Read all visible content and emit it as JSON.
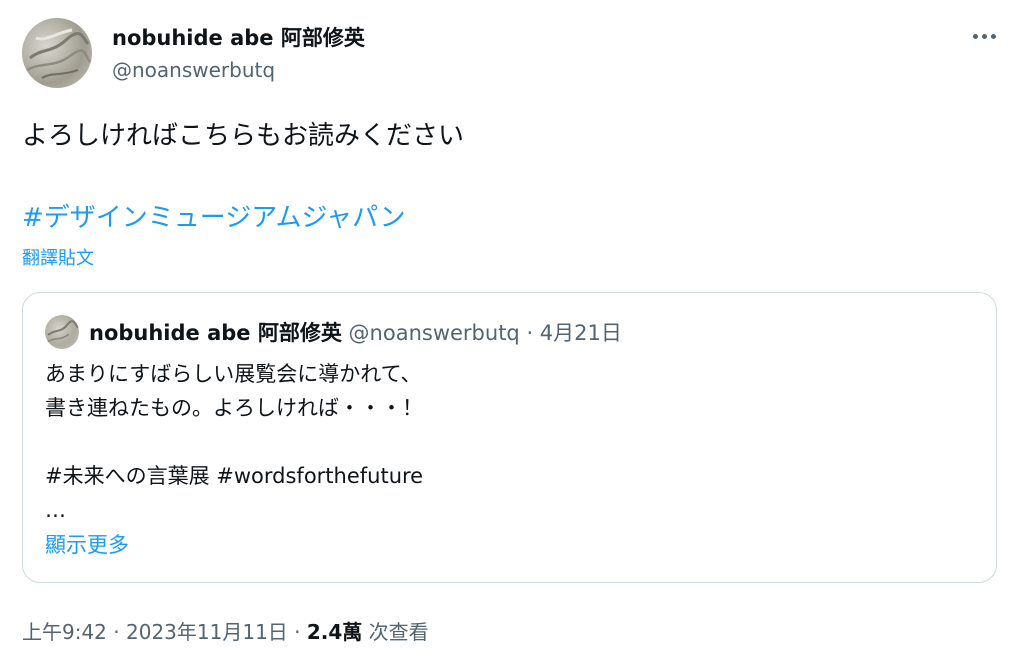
{
  "author": {
    "name": "nobuhide abe 阿部修英",
    "handle": "@noanswerbutq"
  },
  "tweet": {
    "text": "よろしければこちらもお読みください",
    "hashtag": "#デザインミュージアムジャパン",
    "translate_label": "翻譯貼文"
  },
  "quote": {
    "name": "nobuhide abe 阿部修英",
    "handle": "@noanswerbutq",
    "sep": " · ",
    "date": "4月21日",
    "body": "あまりにすばらしい展覧会に導かれて、\n書き連ねたもの。よろしければ・・・！\n\n#未来への言葉展 #wordsforthefuture\n…",
    "show_more": "顯示更多"
  },
  "meta": {
    "time": "上午9:42",
    "date": "2023年11月11日",
    "sep": " · ",
    "views": "2.4萬",
    "views_label": "次查看"
  },
  "icons": {
    "more": "more-horizontal-icon"
  },
  "colors": {
    "link": "#1d9bf0",
    "secondary": "#536471",
    "text": "#0f1419",
    "border": "#cfd9de"
  }
}
